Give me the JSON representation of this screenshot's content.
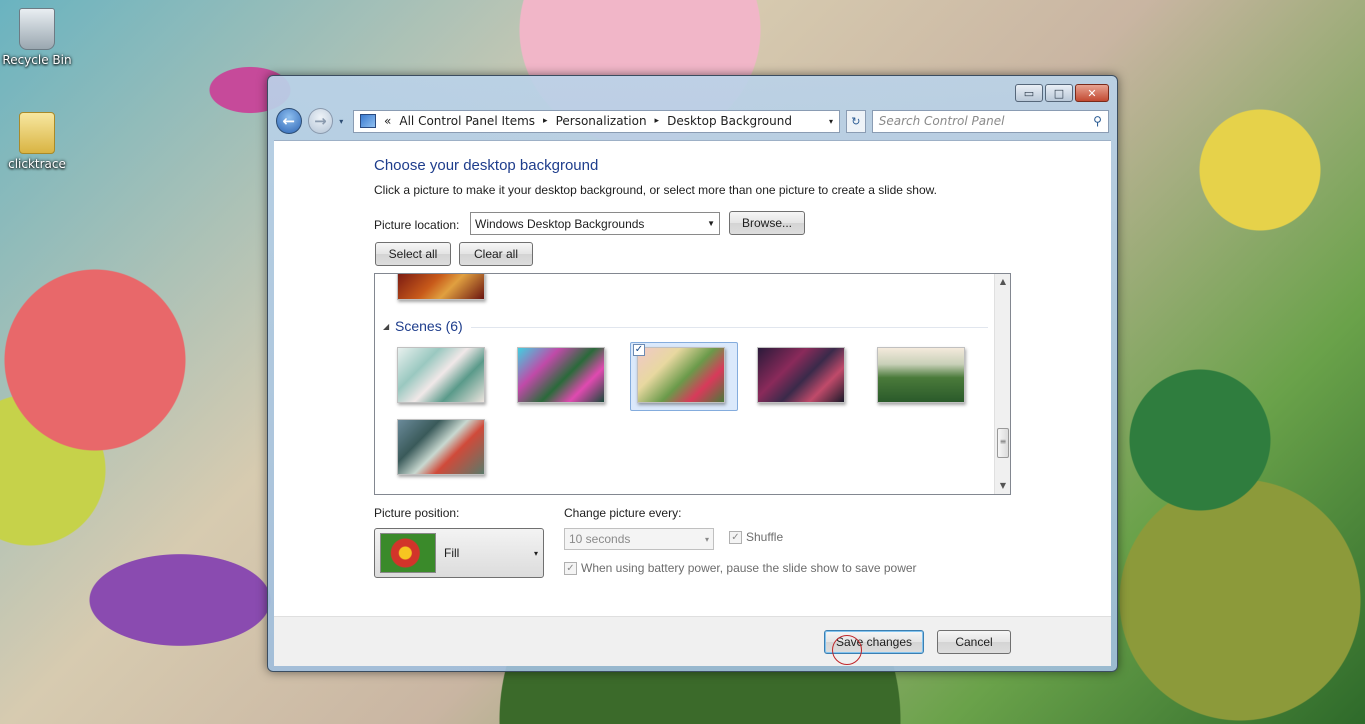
{
  "desktop": {
    "icons": [
      {
        "label": "Recycle Bin",
        "icon": "recycle-bin-icon"
      },
      {
        "label": "clicktrace",
        "icon": "folder-icon"
      }
    ]
  },
  "window": {
    "controls": {
      "minimize": "▭",
      "maximize": "□",
      "close": "✕"
    },
    "nav": {
      "back": "←",
      "forward": "→",
      "history": "▾"
    },
    "address": {
      "overflow": "«",
      "crumbs": [
        "All Control Panel Items",
        "Personalization",
        "Desktop Background"
      ],
      "separator": "▸",
      "dropdown": "▾"
    },
    "refresh": "↻",
    "search": {
      "placeholder": "Search Control Panel",
      "icon": "⚲"
    }
  },
  "page": {
    "title": "Choose your desktop background",
    "description": "Click a picture to make it your desktop background, or select more than one picture to create a slide show.",
    "picture_location": {
      "label": "Picture location:",
      "value": "Windows Desktop Backgrounds"
    },
    "browse_label": "Browse...",
    "select_all_label": "Select all",
    "clear_all_label": "Clear all",
    "gallery": {
      "group_title": "Scenes (6)",
      "group_arrow": "◢",
      "selected_index": 2,
      "check_glyph": "✓",
      "scroll_up": "▲",
      "scroll_down": "▼",
      "scroll_grip": "≡"
    },
    "picture_position": {
      "label": "Picture position:",
      "value": "Fill",
      "arrow": "▾"
    },
    "change_picture": {
      "label": "Change picture every:",
      "value": "10 seconds",
      "arrow": "▾"
    },
    "shuffle": {
      "label": "Shuffle",
      "checked": true
    },
    "battery": {
      "label": "When using battery power, pause the slide show to save power",
      "checked": true
    }
  },
  "footer": {
    "save_label": "Save changes",
    "cancel_label": "Cancel"
  }
}
